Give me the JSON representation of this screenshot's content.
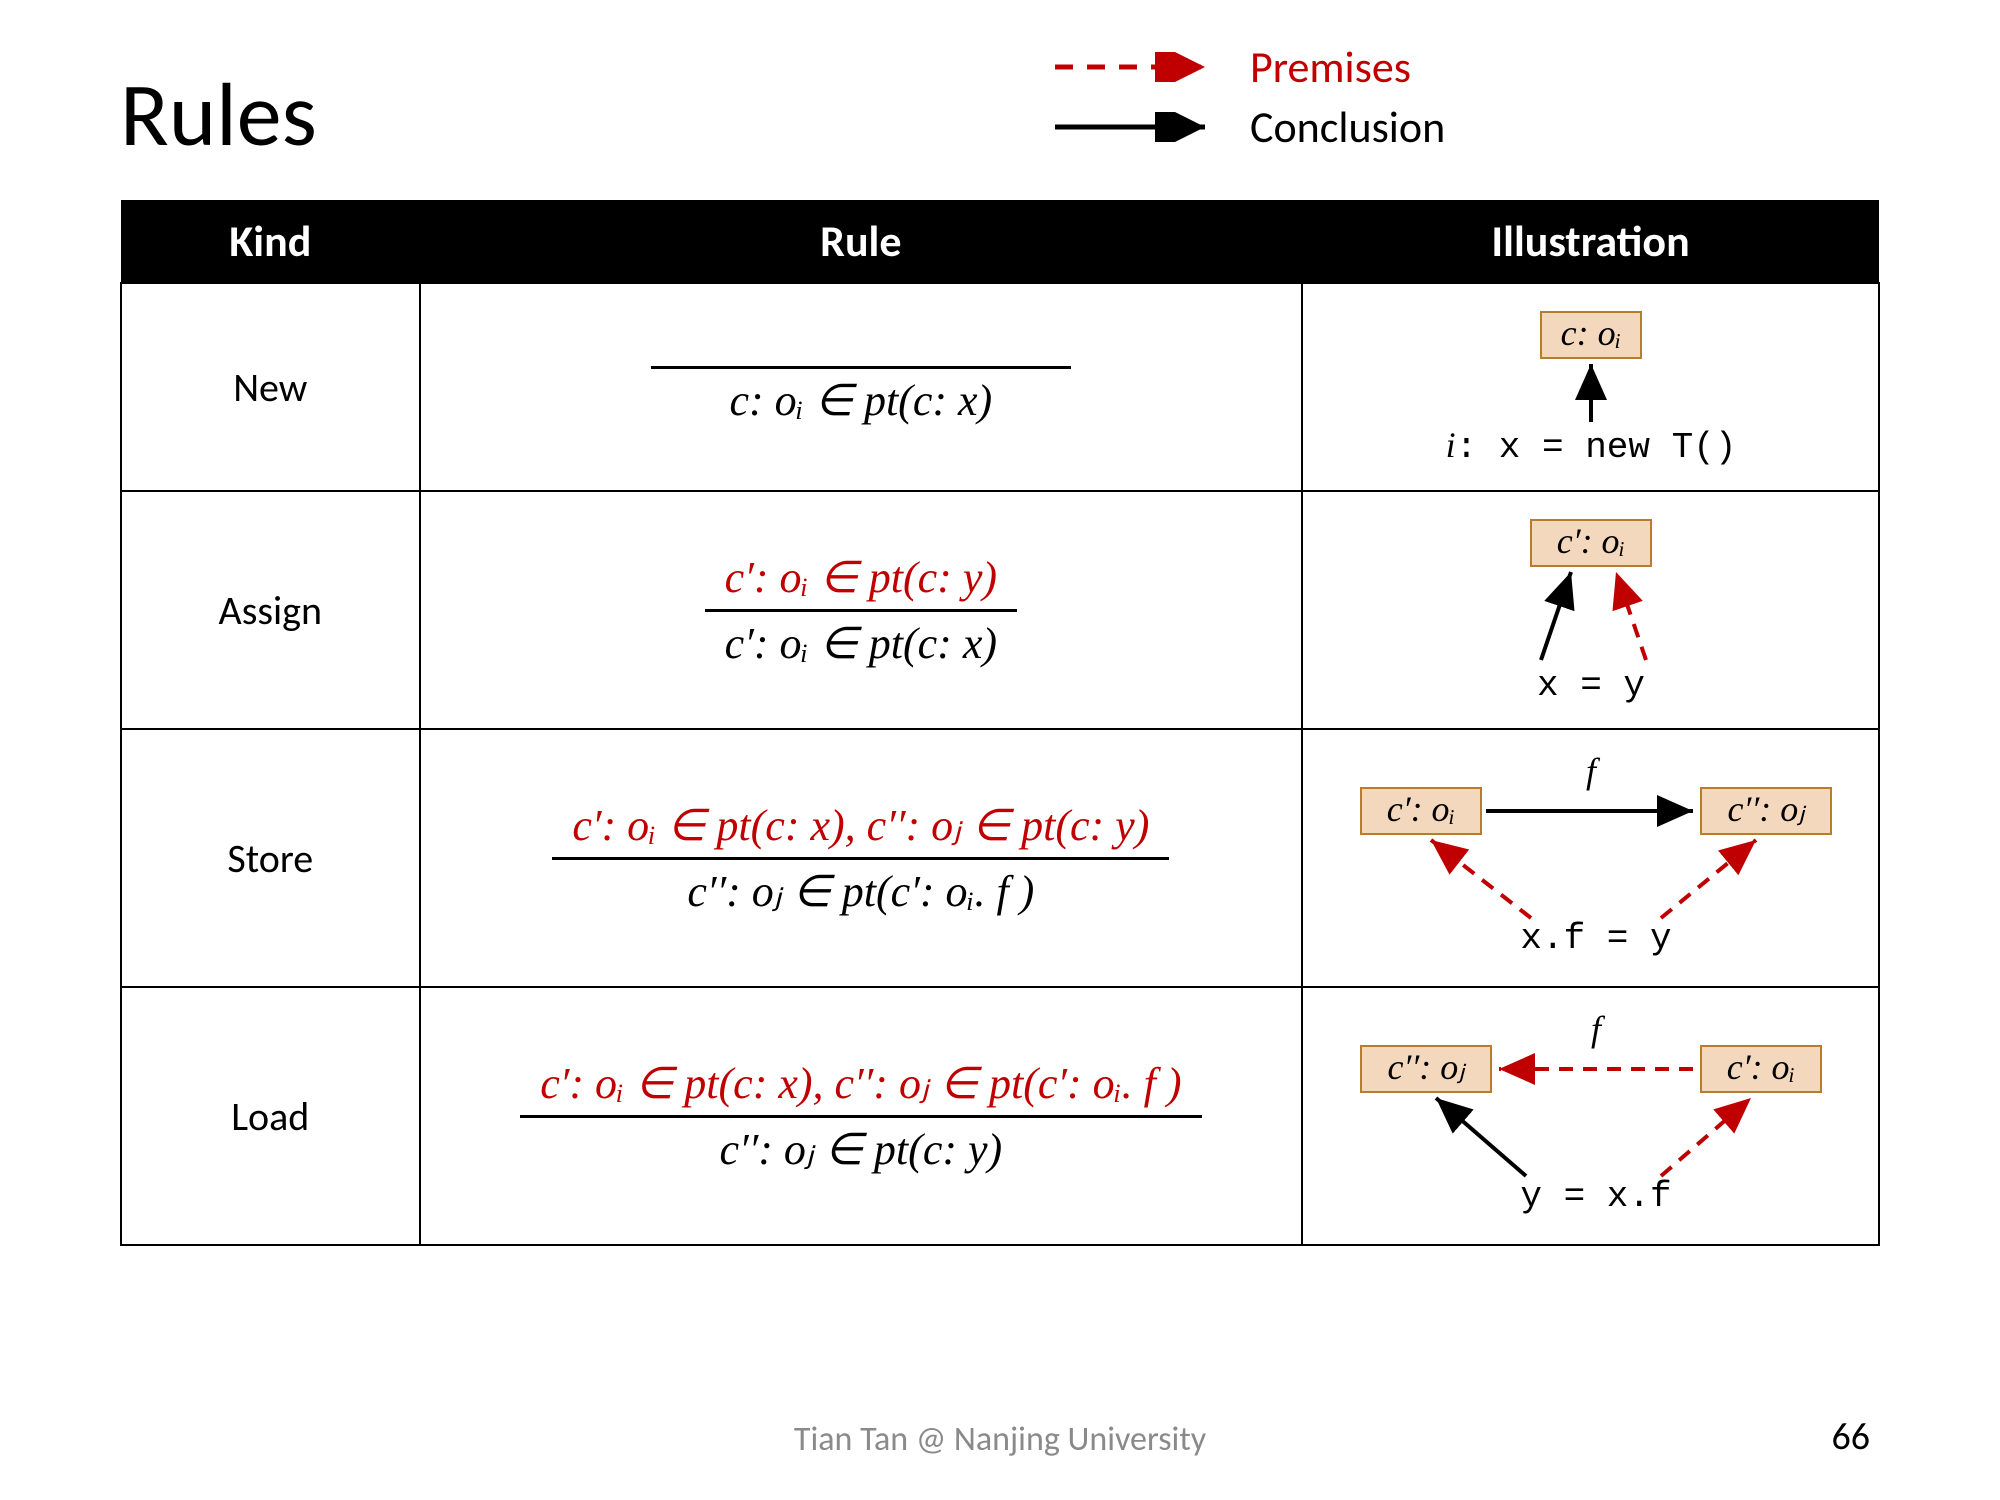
{
  "title": "Rules",
  "legend": {
    "premises": "Premises",
    "conclusion": "Conclusion"
  },
  "headers": {
    "kind": "Kind",
    "rule": "Rule",
    "illus": "Illustration"
  },
  "rows": {
    "new": {
      "kind": "New",
      "concl": "c: oᵢ ∈ pt(c: x)",
      "code": "i: x = new T()",
      "obj": "c: oᵢ"
    },
    "assign": {
      "kind": "Assign",
      "prem": "c′: oᵢ ∈ pt(c: y)",
      "concl": "c′: oᵢ ∈ pt(c: x)",
      "code": "x = y",
      "obj": "c′: oᵢ"
    },
    "store": {
      "kind": "Store",
      "prem": "c′: oᵢ ∈ pt(c: x), c′′: oⱼ ∈ pt(c: y)",
      "concl": "c′′: oⱼ ∈ pt(c′: oᵢ. f )",
      "code": "x.f = y",
      "obj1": "c′: oᵢ",
      "obj2": "c′′: oⱼ",
      "edge": "f"
    },
    "load": {
      "kind": "Load",
      "prem": "c′: oᵢ ∈ pt(c: x), c′′: oⱼ ∈ pt(c′: oᵢ. f )",
      "concl": "c′′: oⱼ ∈ pt(c: y)",
      "code": "y = x.f",
      "obj1": "c′′: oⱼ",
      "obj2": "c′: oᵢ",
      "edge": "f"
    }
  },
  "footer": "Tian Tan @ Nanjing University",
  "page": "66",
  "colors": {
    "premise": "#c00000",
    "black": "#000000",
    "objfill": "#f4d8bd",
    "objstroke": "#b97c2b"
  }
}
